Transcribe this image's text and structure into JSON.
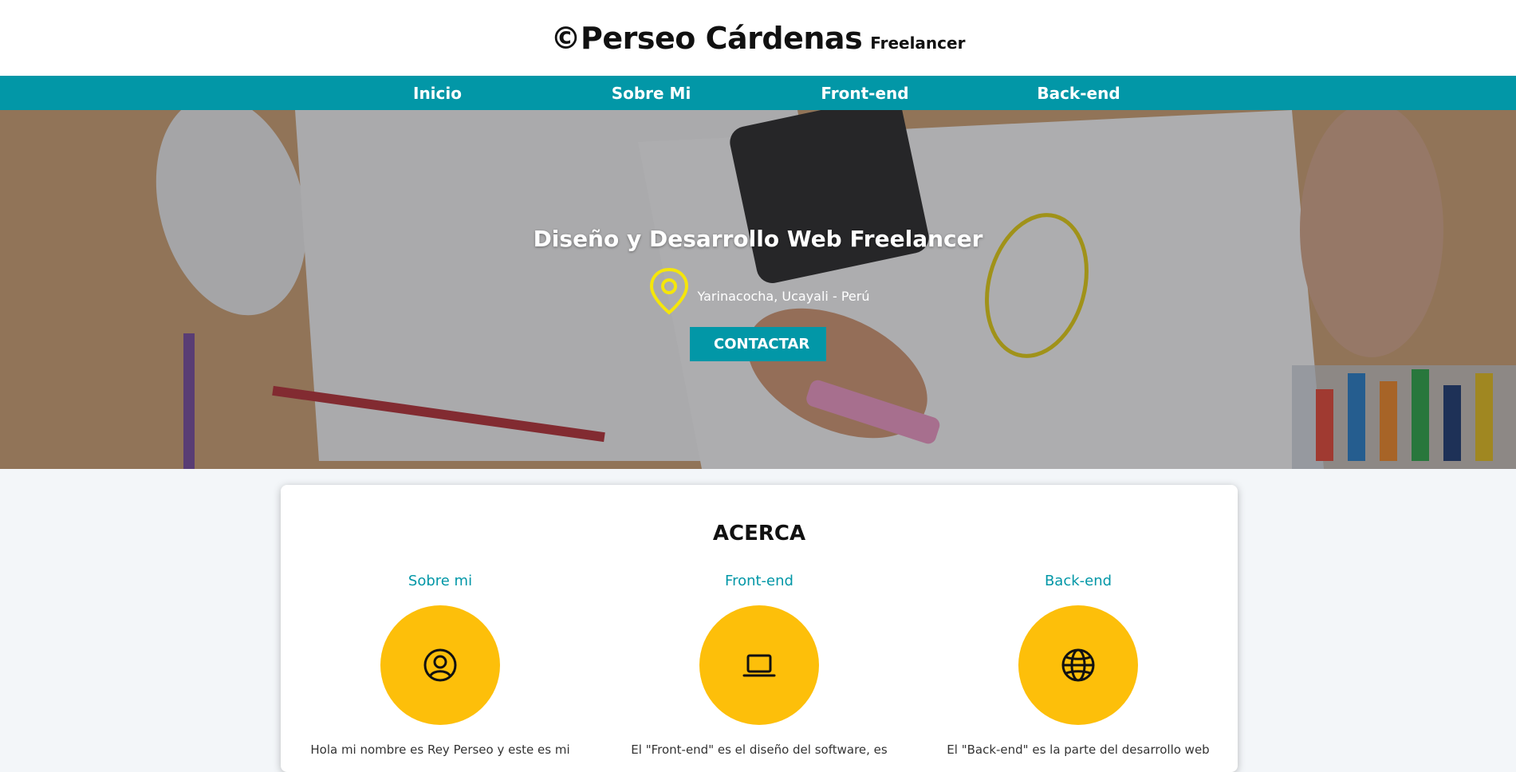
{
  "header": {
    "brand_name": "©Perseo Cárdenas",
    "brand_tag": "Freelancer"
  },
  "nav": {
    "items": [
      "Inicio",
      "Sobre Mi",
      "Front-end",
      "Back-end"
    ]
  },
  "hero": {
    "title": "Diseño y Desarrollo Web Freelancer",
    "location": "Yarinacocha, Ucayali - Perú",
    "contact_label": "CONTACTAR",
    "icon": "map-pin-icon"
  },
  "about": {
    "title": "ACERCA",
    "columns": [
      {
        "title": "Sobre mi",
        "icon": "user-circle-icon",
        "text": "Hola mi nombre es Rey Perseo y este es mi"
      },
      {
        "title": "Front-end",
        "icon": "laptop-icon",
        "text": "El \"Front-end\" es el diseño del software, es"
      },
      {
        "title": "Back-end",
        "icon": "globe-icon",
        "text": "El \"Back-end\" es la parte del desarrollo web"
      }
    ]
  },
  "colors": {
    "accent": "#0297a7",
    "circle": "#fdbf0a",
    "pin": "#f5e60a"
  }
}
